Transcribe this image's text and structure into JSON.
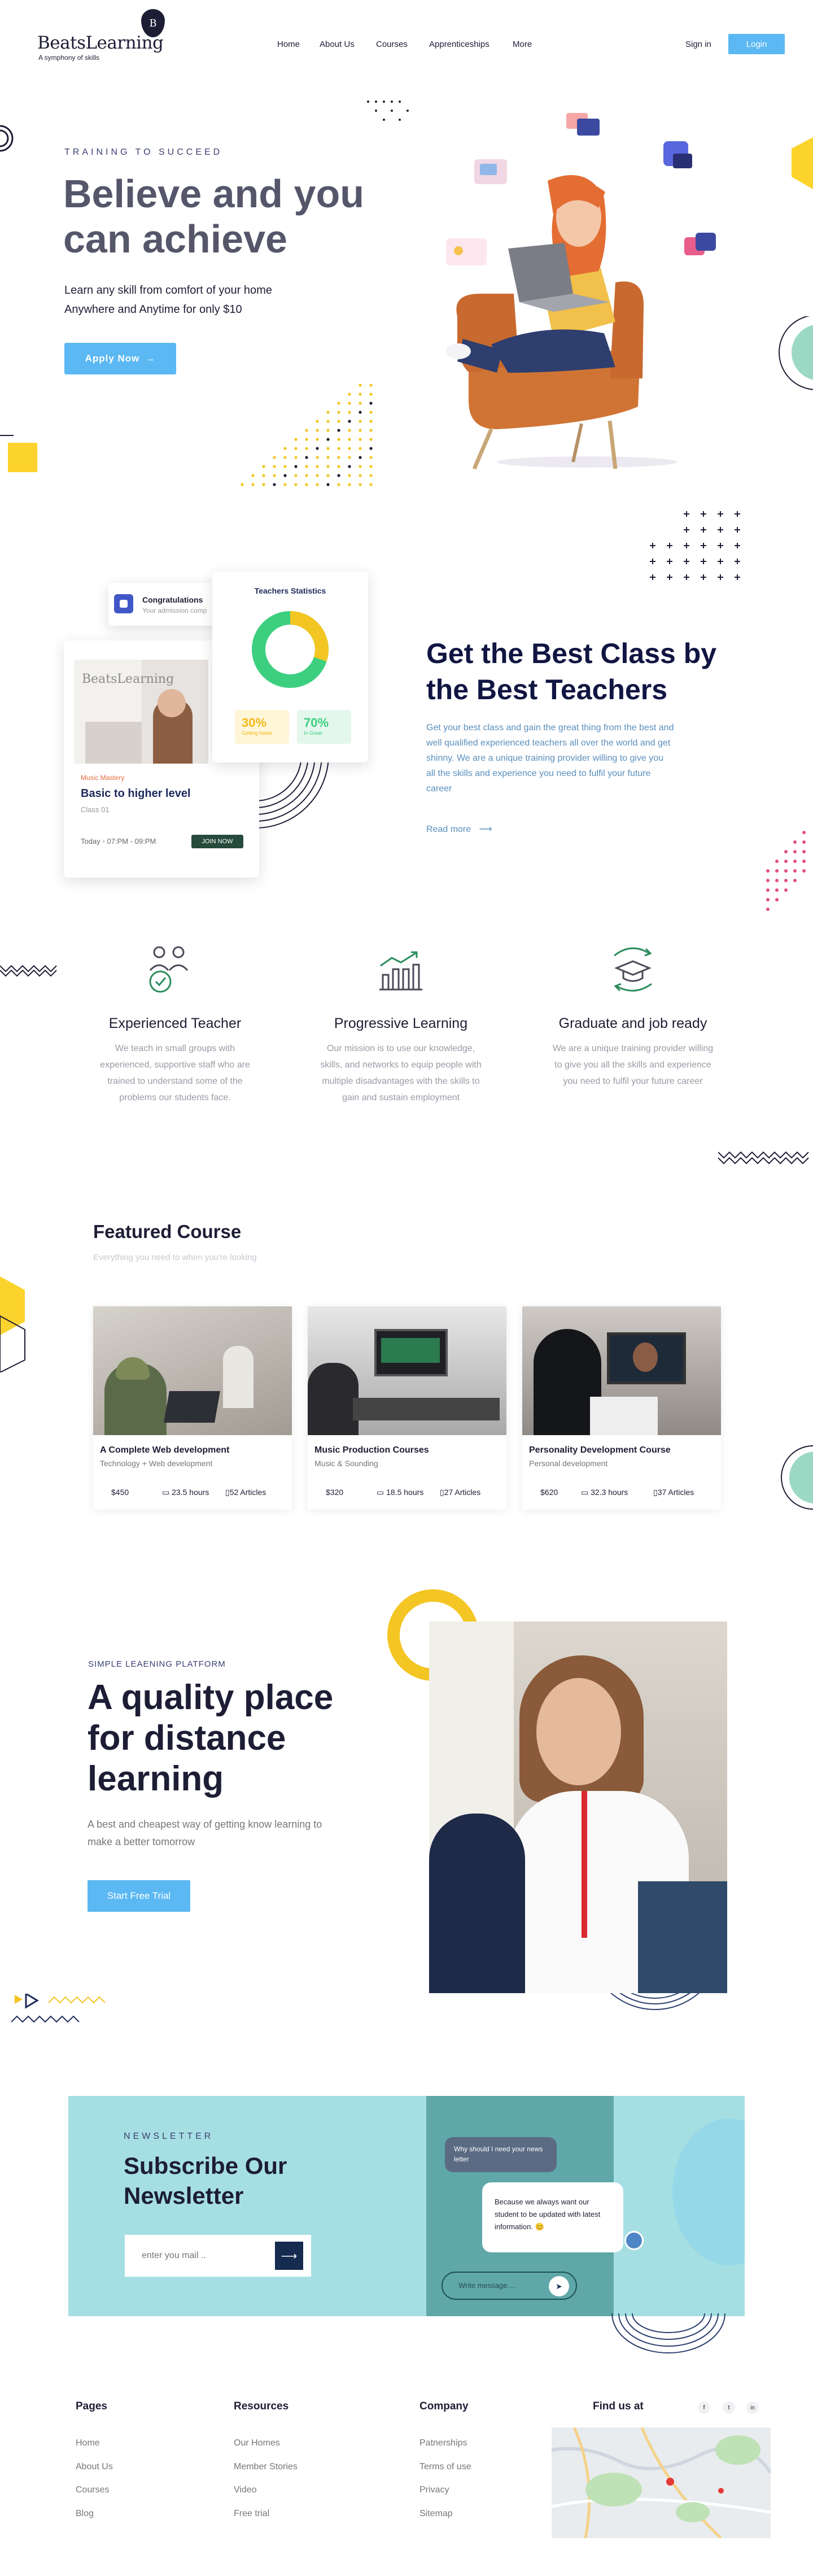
{
  "nav": {
    "logo": "BeatsLearning",
    "logo_badge": "B",
    "tagline": "A symphony of skills",
    "links": [
      "Home",
      "About Us",
      "Courses",
      "Apprenticeships",
      "More"
    ],
    "sign_in": "Sign in",
    "login": "Login"
  },
  "hero": {
    "eyebrow": "TRAINING TO SUCCEED",
    "title_line1": "Believe and you",
    "title_line2": "can achieve",
    "sub_line1": "Learn any skill from comfort of your home",
    "sub_line2": "Anywhere and Anytime for only $10",
    "cta": "Apply Now",
    "cta_icon": "arrow-right-icon"
  },
  "best": {
    "congrats_title": "Congratulations",
    "congrats_sub": "Your admission comp",
    "stats_title": "Teachers Statistics",
    "stat_a_value": "30%",
    "stat_a_label": "Getting better",
    "stat_b_value": "70%",
    "stat_b_label": "In Great",
    "chart": {
      "a": 30,
      "b": 70,
      "color_a": "#f3c623",
      "color_b": "#3ccf7f"
    },
    "class_tag": "Music Mastery",
    "class_title": "Basic to higher level",
    "class_sub": "Class 01",
    "class_time_a": "Today",
    "class_time_b": "07:PM - 09:PM",
    "join": "JOIN NOW",
    "title_line1": "Get the Best Class by",
    "title_line2": "the Best Teachers",
    "desc": "Get your best class and gain the great thing from the best and well qualified experienced teachers all over the world and get shinny. We are a unique training provider willing to give you all the skills and experience you need to fulfil your future career",
    "read_more": "Read more"
  },
  "features": [
    {
      "icon": "teacher-check-icon",
      "title": "Experienced Teacher",
      "desc": "We teach in small groups with experienced, supportive staff who are trained to understand some of the problems our students face."
    },
    {
      "icon": "progress-chart-icon",
      "title": "Progressive Learning",
      "desc": "Our mission is to use our knowledge, skills, and networks to equip people with multiple disadvantages with the skills to gain and sustain employment"
    },
    {
      "icon": "graduation-cap-icon",
      "title": "Graduate and  job ready",
      "desc": "We are a unique training provider willing to give you all the skills and experience you need to fulfil your future career"
    }
  ],
  "featured": {
    "title": "Featured Course",
    "sub": "Everything you need to  when you're looking",
    "courses": [
      {
        "title": "A Complete Web development",
        "cat": "Technology + Web development",
        "price": "$450",
        "hours": "23.5 hours",
        "articles": "52 Articles"
      },
      {
        "title": "Music Production Courses",
        "cat": "Music & Sounding",
        "price": "$320",
        "hours": "18.5 hours",
        "articles": "27 Articles"
      },
      {
        "title": "Personality Development Course",
        "cat": "Personal development",
        "price": "$620",
        "hours": "32.3 hours",
        "articles": "37 Articles"
      }
    ]
  },
  "distance": {
    "eyebrow": "SIMPLE LEAENING PLATFORM",
    "title_line1": "A quality place",
    "title_line2": "for distance",
    "title_line3": "learning",
    "sub": "A best and cheapest way of getting know learning to make a better tomorrow",
    "cta": "Start Free Trial"
  },
  "newsletter": {
    "eyebrow": "NEWSLETTER",
    "title": "Subscribe Our Newsletter",
    "placeholder": "enter you mail ..",
    "bubble_q": "Why should I need your news letter",
    "bubble_a": "Because we always want our student to be updated with latest information. 😊",
    "message_placeholder": "Write message....",
    "colors": {
      "panel": "#a6dfe3",
      "accent": "#152b50"
    }
  },
  "footer": {
    "columns": [
      {
        "title": "Pages",
        "links": [
          "Home",
          "About Us",
          "Courses",
          "Blog"
        ]
      },
      {
        "title": "Resources",
        "links": [
          "Our Homes",
          "Member Stories",
          "Video",
          "Free trial"
        ]
      },
      {
        "title": "Company",
        "links": [
          "Patnerships",
          "Terms of use",
          "Privacy",
          "Sitemap"
        ]
      }
    ],
    "find_us": "Find us at",
    "social": [
      "f",
      "t",
      "in"
    ]
  }
}
